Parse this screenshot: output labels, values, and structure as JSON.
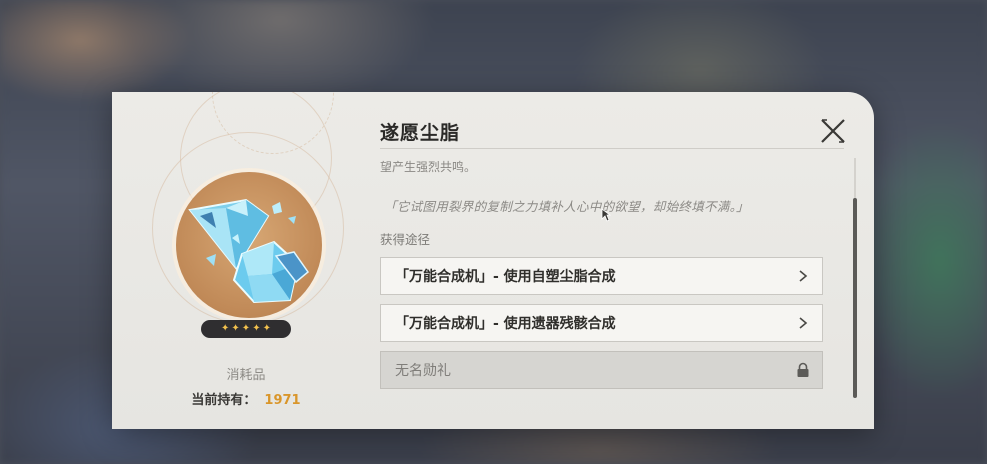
{
  "item": {
    "name": "遂愿尘脂",
    "rarity_stars": 5,
    "type": "消耗品",
    "hold_label": "当前持有：",
    "hold_count": "1971",
    "desc_partial": "望产生强烈共鸣。",
    "flavor_text": "「它试图用裂界的复制之力填补人心中的欲望，却始终填不满。」"
  },
  "sources": {
    "label": "获得途径",
    "items": [
      {
        "label": "「万能合成机」- 使用自塑尘脂合成",
        "locked": false
      },
      {
        "label": "「万能合成机」- 使用遗器残骸合成",
        "locked": false
      },
      {
        "label": "无名勋礼",
        "locked": true
      }
    ]
  },
  "icons": {
    "close": "close-x-icon",
    "chevron": "chevron-right-icon",
    "lock": "lock-icon",
    "item": "crystal-item-icon"
  },
  "colors": {
    "accent_gold": "#d9962b",
    "star": "#f3c24e"
  }
}
